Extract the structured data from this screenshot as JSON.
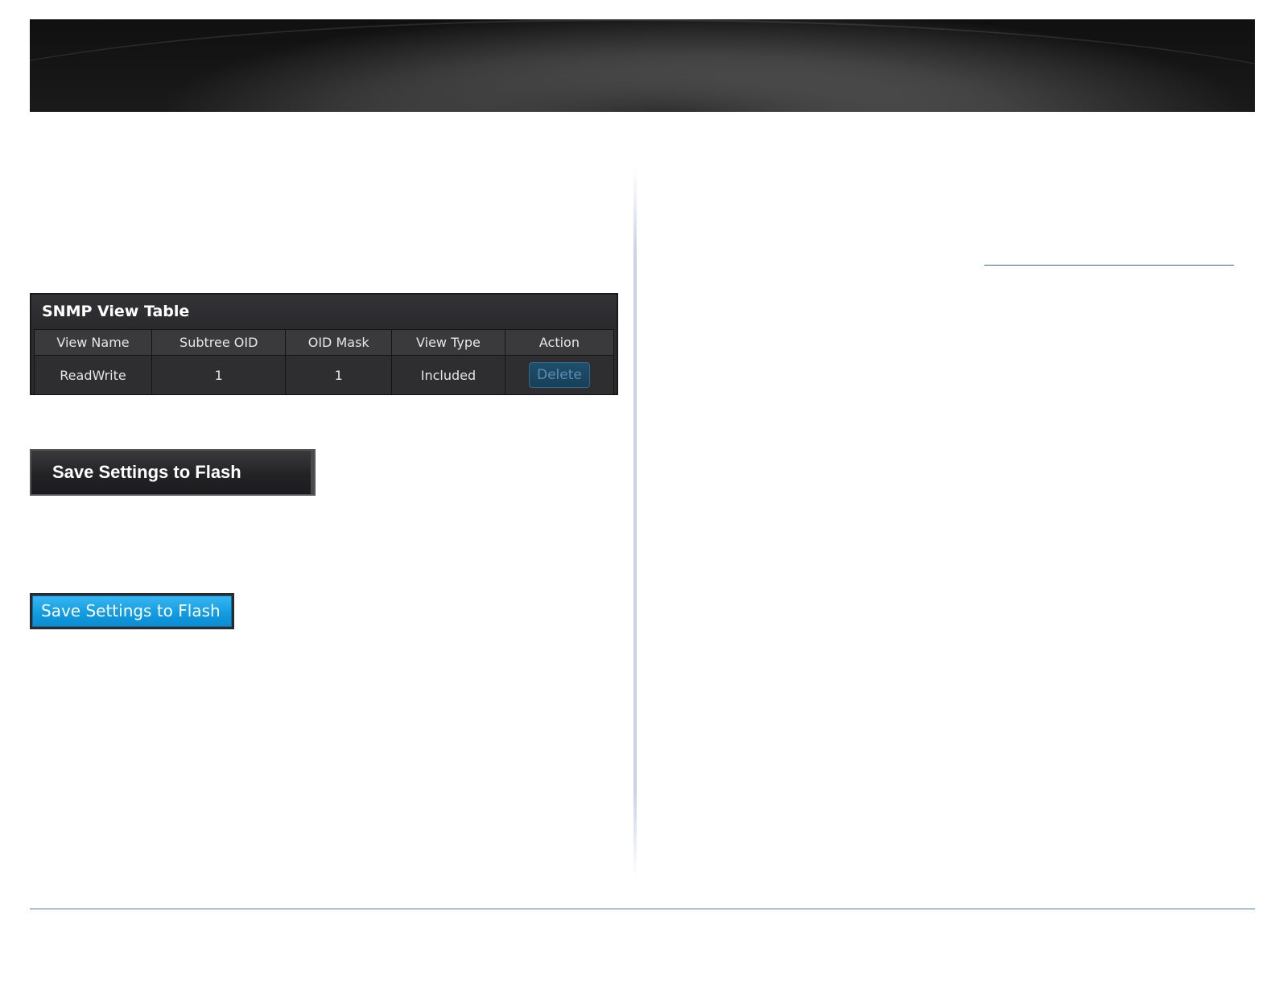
{
  "snmp_view_table": {
    "title": "SNMP View Table",
    "columns": [
      "View Name",
      "Subtree OID",
      "OID Mask",
      "View Type",
      "Action"
    ],
    "rows": [
      {
        "view_name": "ReadWrite",
        "subtree_oid": "1",
        "oid_mask": "1",
        "view_type": "Included",
        "action_label": "Delete"
      }
    ]
  },
  "buttons": {
    "save_dark_label": "Save Settings to Flash",
    "save_blue_label": "Save Settings to Flash"
  },
  "colors": {
    "accent_blue": "#119be0",
    "panel_dark": "#2b2b2e",
    "rule_blue": "#4a7bd0"
  }
}
